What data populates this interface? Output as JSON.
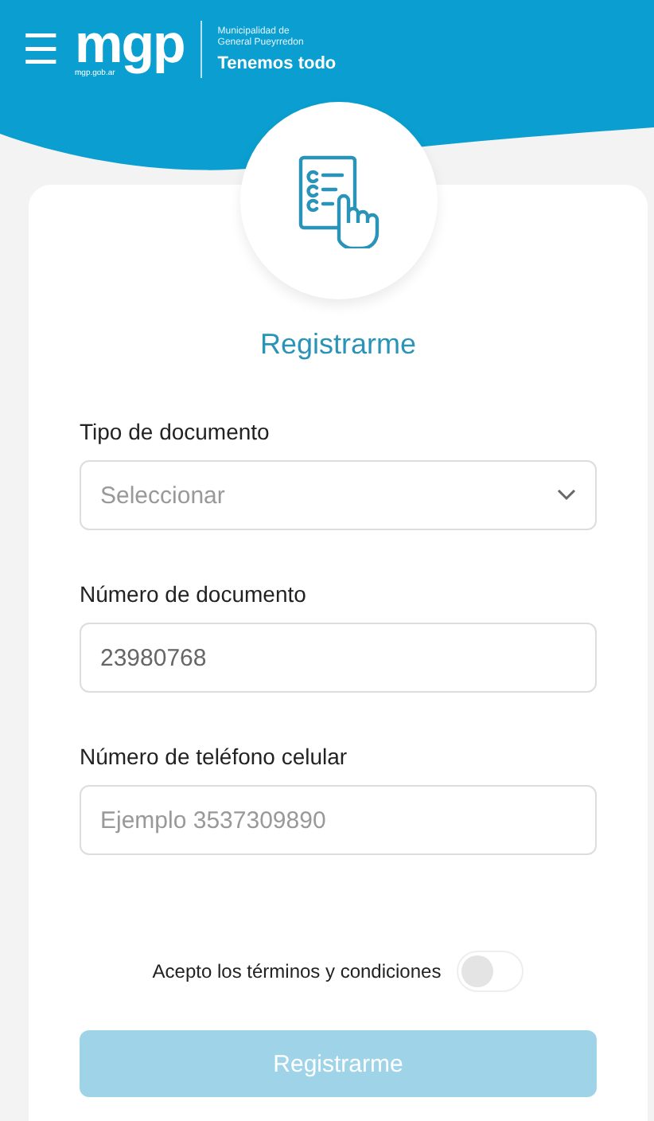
{
  "header": {
    "menu_icon": "☰",
    "logo": "mgp",
    "logo_url": "mgp.gob.ar",
    "org_name": "Municipalidad de General Pueyrredon",
    "slogan": "Tenemos todo"
  },
  "title": "Registrarme",
  "fields": [
    {
      "label": "Tipo de documento",
      "kind": "select",
      "placeholder": "Seleccionar"
    },
    {
      "label": "Número de documento",
      "kind": "text",
      "value": "23980768"
    },
    {
      "label": "Número de teléfono celular",
      "kind": "text",
      "placeholder": "Ejemplo 3537309890"
    }
  ],
  "terms": {
    "label": "Acepto los términos y condiciones",
    "on": false
  },
  "submit": {
    "label": "Registrarme",
    "disabled": true
  }
}
